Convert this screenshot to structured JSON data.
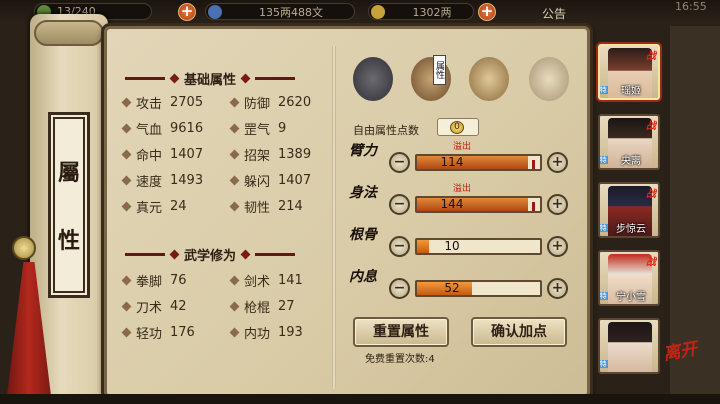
{
  "topbar": {
    "resource1": "13/240",
    "resource2": "135两488文",
    "resource3": "1302两",
    "notice": "公告",
    "clock": "16:55"
  },
  "sidebar": {
    "title_line1": "屬",
    "title_line2": "性"
  },
  "base_attributes": {
    "title": "基础属性",
    "items": [
      {
        "name": "攻击",
        "value": "2705"
      },
      {
        "name": "防御",
        "value": "2620"
      },
      {
        "name": "气血",
        "value": "9616"
      },
      {
        "name": "罡气",
        "value": "9"
      },
      {
        "name": "命中",
        "value": "1407"
      },
      {
        "name": "招架",
        "value": "1389"
      },
      {
        "name": "速度",
        "value": "1493"
      },
      {
        "name": "躲闪",
        "value": "1407"
      },
      {
        "name": "真元",
        "value": "24"
      },
      {
        "name": "韧性",
        "value": "214"
      }
    ]
  },
  "martial_arts": {
    "title": "武学修为",
    "items": [
      {
        "name": "拳脚",
        "value": "76"
      },
      {
        "name": "剑术",
        "value": "141"
      },
      {
        "name": "刀术",
        "value": "42"
      },
      {
        "name": "枪棍",
        "value": "27"
      },
      {
        "name": "轻功",
        "value": "176"
      },
      {
        "name": "内功",
        "value": "193"
      }
    ]
  },
  "allocation": {
    "tab_label": "属性",
    "free_points_label": "自由属性点数",
    "free_points": "0",
    "rows": [
      {
        "label": "臂力",
        "value": "114",
        "level": 0.9,
        "overflow": "溢出",
        "minus": "−",
        "plus": "+"
      },
      {
        "label": "身法",
        "value": "144",
        "level": 0.9,
        "overflow": "溢出",
        "minus": "−",
        "plus": "+"
      },
      {
        "label": "根骨",
        "value": "10",
        "level": 0.1,
        "overflow": "",
        "minus": "−",
        "plus": "+"
      },
      {
        "label": "内息",
        "value": "52",
        "level": 0.45,
        "overflow": "",
        "minus": "−",
        "plus": "+"
      }
    ],
    "reset_button": "重置属性",
    "confirm_button": "确认加点",
    "reset_note": "免费重置次数:4"
  },
  "characters": [
    {
      "name": "瑶姬",
      "badge": "战",
      "flag": "特"
    },
    {
      "name": "央离",
      "badge": "战",
      "flag": "特"
    },
    {
      "name": "步惊云",
      "badge": "战",
      "flag": "特"
    },
    {
      "name": "宁小雪",
      "badge": "战",
      "flag": "特"
    },
    {
      "name": "",
      "badge": "",
      "flag": "特"
    }
  ],
  "leave_label": "离开",
  "colors": {
    "accent": "#c01a10",
    "bar_fill": "#e0802c",
    "parchment": "#ddd0ae"
  }
}
